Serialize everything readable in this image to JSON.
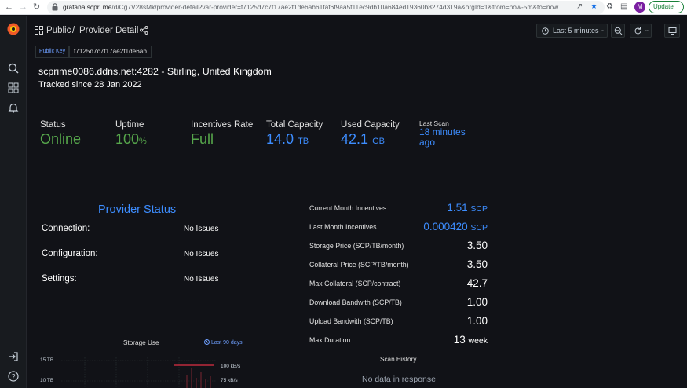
{
  "browser": {
    "url_host": "grafana.scpri.me",
    "url_rest": "/d/Cg7V28sMk/provider-detail?var-provider=f7125d7c7f17ae2f1de6ab61faf6f9aa5f11ec9db10a684ed19360b8274d319a&orgId=1&from=now-5m&to=now",
    "avatar_letter": "M",
    "update_label": "Update"
  },
  "header": {
    "folder": "Public",
    "separator": "/",
    "title": "Provider Detail",
    "time_range": "Last 5 minutes"
  },
  "public_key": {
    "label": "Public Key",
    "value": "f7125d7c7f17ae2f1de6ab"
  },
  "host": {
    "line": "scprime0086.ddns.net:4282 - Stirling, United Kingdom",
    "tracked": "Tracked since 28 Jan 2022"
  },
  "stats": {
    "status": {
      "label": "Status",
      "value": "Online"
    },
    "uptime": {
      "label": "Uptime",
      "value": "100",
      "unit": "%"
    },
    "incentives_rate": {
      "label": "Incentives Rate",
      "value": "Full"
    },
    "total_capacity": {
      "label": "Total Capacity",
      "value": "14.0",
      "unit": "TB"
    },
    "used_capacity": {
      "label": "Used Capacity",
      "value": "42.1",
      "unit": "GB"
    },
    "last_scan": {
      "label": "Last Scan",
      "value": "18 minutes ago"
    }
  },
  "provider_status": {
    "title": "Provider Status",
    "rows": [
      {
        "label": "Connection:",
        "value": "No Issues"
      },
      {
        "label": "Configuration:",
        "value": "No Issues"
      },
      {
        "label": "Settings:",
        "value": "No Issues"
      }
    ]
  },
  "pricing": [
    {
      "label": "Current Month Incentives",
      "value": "1.51",
      "unit": "SCP"
    },
    {
      "label": "Last Month Incentives",
      "value": "0.000420",
      "unit": "SCP"
    },
    {
      "label": "Storage Price (SCP/TB/month)",
      "value": "3.50",
      "unit": ""
    },
    {
      "label": "Collateral Price (SCP/TB/month)",
      "value": "3.50",
      "unit": ""
    },
    {
      "label": "Max Collateral (SCP/contract)",
      "value": "42.7",
      "unit": ""
    },
    {
      "label": "Download Bandwith (SCP/TB)",
      "value": "1.00",
      "unit": ""
    },
    {
      "label": "Upload Bandwith (SCP/TB)",
      "value": "1.00",
      "unit": ""
    },
    {
      "label": "Max Duration",
      "value": "13",
      "unit": "week"
    }
  ],
  "storage_use": {
    "title": "Storage Use",
    "range": "Last 90 days",
    "y_ticks": [
      "15 TB",
      "10 TB"
    ],
    "y2_ticks": [
      "100 kB/s",
      "75 kB/s"
    ]
  },
  "scan_history": {
    "title": "Scan History",
    "empty": "No data in response"
  },
  "colors": {
    "background": "#111217",
    "accent_blue": "#3d8dff",
    "ok_green": "#56a64b",
    "threshold_red": "#e02f44"
  }
}
